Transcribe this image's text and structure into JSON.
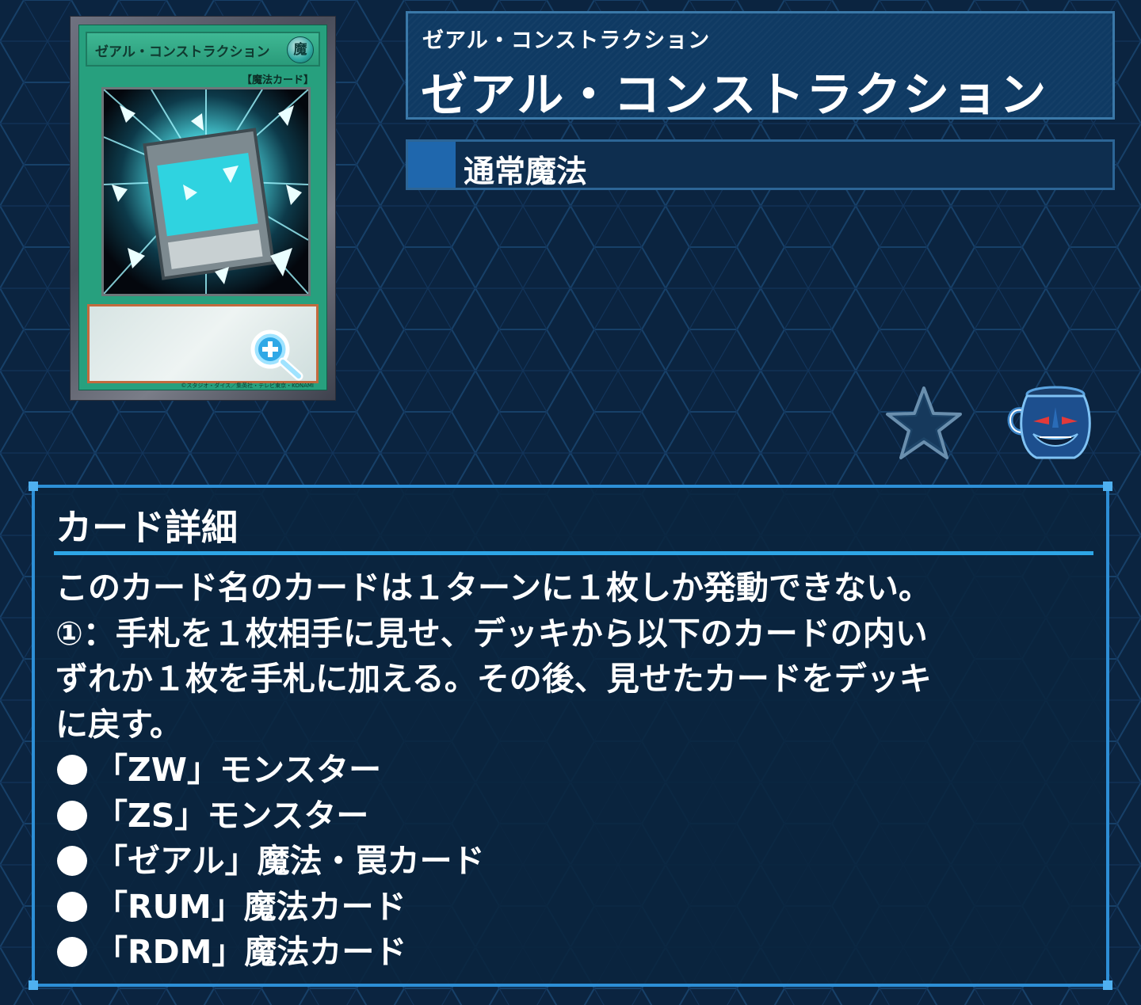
{
  "card": {
    "name": "ゼアル・コンストラクション",
    "attribute_glyph": "魔",
    "type_label": "【魔法カード】",
    "copyright": "©スタジオ・ダイス／集英社・テレビ東京・KONAMI",
    "frame_color": "#27a07e",
    "zoom_icon": "magnifier-plus-icon"
  },
  "title": {
    "ruby": "ゼアル・コンストラクション",
    "main": "ゼアル・コンストラクション"
  },
  "type": {
    "label": "通常魔法"
  },
  "actions": {
    "favorite_icon": "star-icon",
    "pot_icon": "pot-of-greed-icon"
  },
  "details": {
    "heading": "カード詳細",
    "lines": [
      "このカード名のカードは１ターンに１枚しか発動できない。",
      "①：手札を１枚相手に見せ、デッキから以下のカードの内い",
      "ずれか１枚を手札に加える。その後、見せたカードをデッキ",
      "に戻す。"
    ],
    "bullets": [
      "「ZW」モンスター",
      "「ZS」モンスター",
      "「ゼアル」魔法・罠カード",
      "「RUM」魔法カード",
      "「RDM」魔法カード"
    ]
  },
  "colors": {
    "background": "#0b2440",
    "panel_border": "#2d8fd6",
    "accent": "#2ea6e6"
  }
}
